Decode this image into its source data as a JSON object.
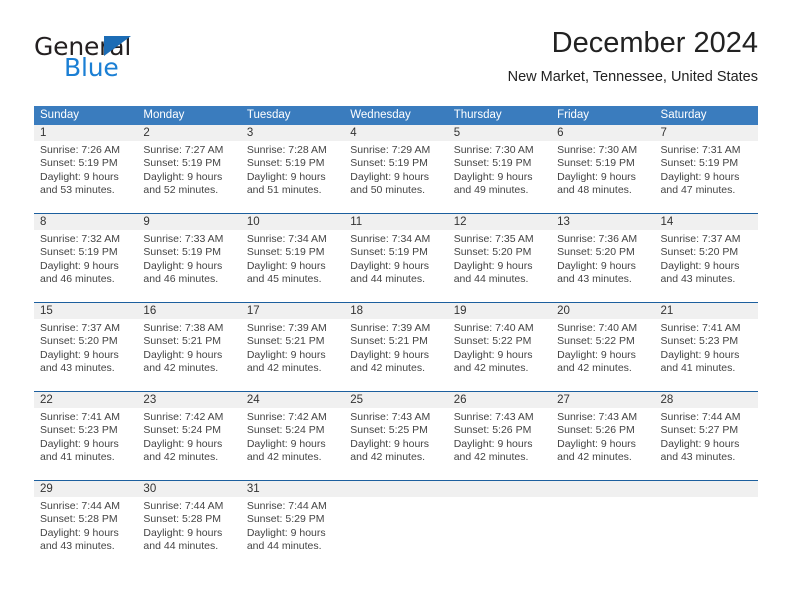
{
  "brand": {
    "name_part1": "General",
    "name_part2": "Blue",
    "triangle_icon": "triangle-icon",
    "colors": {
      "general": "#231f20",
      "blue": "#1b7fd4",
      "triangle": "#1c6cb5"
    }
  },
  "header": {
    "title": "December 2024",
    "location": "New Market, Tennessee, United States"
  },
  "theme": {
    "header_band": "#3a7cbe",
    "week_divider": "#1c5f9e",
    "daynum_band": "#f0f0f0",
    "text": "#444444"
  },
  "calendar": {
    "day_headers": [
      "Sunday",
      "Monday",
      "Tuesday",
      "Wednesday",
      "Thursday",
      "Friday",
      "Saturday"
    ],
    "weeks": [
      {
        "numbers": [
          "1",
          "2",
          "3",
          "4",
          "5",
          "6",
          "7"
        ],
        "days": [
          {
            "sunrise": "Sunrise: 7:26 AM",
            "sunset": "Sunset: 5:19 PM",
            "daylight1": "Daylight: 9 hours",
            "daylight2": "and 53 minutes."
          },
          {
            "sunrise": "Sunrise: 7:27 AM",
            "sunset": "Sunset: 5:19 PM",
            "daylight1": "Daylight: 9 hours",
            "daylight2": "and 52 minutes."
          },
          {
            "sunrise": "Sunrise: 7:28 AM",
            "sunset": "Sunset: 5:19 PM",
            "daylight1": "Daylight: 9 hours",
            "daylight2": "and 51 minutes."
          },
          {
            "sunrise": "Sunrise: 7:29 AM",
            "sunset": "Sunset: 5:19 PM",
            "daylight1": "Daylight: 9 hours",
            "daylight2": "and 50 minutes."
          },
          {
            "sunrise": "Sunrise: 7:30 AM",
            "sunset": "Sunset: 5:19 PM",
            "daylight1": "Daylight: 9 hours",
            "daylight2": "and 49 minutes."
          },
          {
            "sunrise": "Sunrise: 7:30 AM",
            "sunset": "Sunset: 5:19 PM",
            "daylight1": "Daylight: 9 hours",
            "daylight2": "and 48 minutes."
          },
          {
            "sunrise": "Sunrise: 7:31 AM",
            "sunset": "Sunset: 5:19 PM",
            "daylight1": "Daylight: 9 hours",
            "daylight2": "and 47 minutes."
          }
        ]
      },
      {
        "numbers": [
          "8",
          "9",
          "10",
          "11",
          "12",
          "13",
          "14"
        ],
        "days": [
          {
            "sunrise": "Sunrise: 7:32 AM",
            "sunset": "Sunset: 5:19 PM",
            "daylight1": "Daylight: 9 hours",
            "daylight2": "and 46 minutes."
          },
          {
            "sunrise": "Sunrise: 7:33 AM",
            "sunset": "Sunset: 5:19 PM",
            "daylight1": "Daylight: 9 hours",
            "daylight2": "and 46 minutes."
          },
          {
            "sunrise": "Sunrise: 7:34 AM",
            "sunset": "Sunset: 5:19 PM",
            "daylight1": "Daylight: 9 hours",
            "daylight2": "and 45 minutes."
          },
          {
            "sunrise": "Sunrise: 7:34 AM",
            "sunset": "Sunset: 5:19 PM",
            "daylight1": "Daylight: 9 hours",
            "daylight2": "and 44 minutes."
          },
          {
            "sunrise": "Sunrise: 7:35 AM",
            "sunset": "Sunset: 5:20 PM",
            "daylight1": "Daylight: 9 hours",
            "daylight2": "and 44 minutes."
          },
          {
            "sunrise": "Sunrise: 7:36 AM",
            "sunset": "Sunset: 5:20 PM",
            "daylight1": "Daylight: 9 hours",
            "daylight2": "and 43 minutes."
          },
          {
            "sunrise": "Sunrise: 7:37 AM",
            "sunset": "Sunset: 5:20 PM",
            "daylight1": "Daylight: 9 hours",
            "daylight2": "and 43 minutes."
          }
        ]
      },
      {
        "numbers": [
          "15",
          "16",
          "17",
          "18",
          "19",
          "20",
          "21"
        ],
        "days": [
          {
            "sunrise": "Sunrise: 7:37 AM",
            "sunset": "Sunset: 5:20 PM",
            "daylight1": "Daylight: 9 hours",
            "daylight2": "and 43 minutes."
          },
          {
            "sunrise": "Sunrise: 7:38 AM",
            "sunset": "Sunset: 5:21 PM",
            "daylight1": "Daylight: 9 hours",
            "daylight2": "and 42 minutes."
          },
          {
            "sunrise": "Sunrise: 7:39 AM",
            "sunset": "Sunset: 5:21 PM",
            "daylight1": "Daylight: 9 hours",
            "daylight2": "and 42 minutes."
          },
          {
            "sunrise": "Sunrise: 7:39 AM",
            "sunset": "Sunset: 5:21 PM",
            "daylight1": "Daylight: 9 hours",
            "daylight2": "and 42 minutes."
          },
          {
            "sunrise": "Sunrise: 7:40 AM",
            "sunset": "Sunset: 5:22 PM",
            "daylight1": "Daylight: 9 hours",
            "daylight2": "and 42 minutes."
          },
          {
            "sunrise": "Sunrise: 7:40 AM",
            "sunset": "Sunset: 5:22 PM",
            "daylight1": "Daylight: 9 hours",
            "daylight2": "and 42 minutes."
          },
          {
            "sunrise": "Sunrise: 7:41 AM",
            "sunset": "Sunset: 5:23 PM",
            "daylight1": "Daylight: 9 hours",
            "daylight2": "and 41 minutes."
          }
        ]
      },
      {
        "numbers": [
          "22",
          "23",
          "24",
          "25",
          "26",
          "27",
          "28"
        ],
        "days": [
          {
            "sunrise": "Sunrise: 7:41 AM",
            "sunset": "Sunset: 5:23 PM",
            "daylight1": "Daylight: 9 hours",
            "daylight2": "and 41 minutes."
          },
          {
            "sunrise": "Sunrise: 7:42 AM",
            "sunset": "Sunset: 5:24 PM",
            "daylight1": "Daylight: 9 hours",
            "daylight2": "and 42 minutes."
          },
          {
            "sunrise": "Sunrise: 7:42 AM",
            "sunset": "Sunset: 5:24 PM",
            "daylight1": "Daylight: 9 hours",
            "daylight2": "and 42 minutes."
          },
          {
            "sunrise": "Sunrise: 7:43 AM",
            "sunset": "Sunset: 5:25 PM",
            "daylight1": "Daylight: 9 hours",
            "daylight2": "and 42 minutes."
          },
          {
            "sunrise": "Sunrise: 7:43 AM",
            "sunset": "Sunset: 5:26 PM",
            "daylight1": "Daylight: 9 hours",
            "daylight2": "and 42 minutes."
          },
          {
            "sunrise": "Sunrise: 7:43 AM",
            "sunset": "Sunset: 5:26 PM",
            "daylight1": "Daylight: 9 hours",
            "daylight2": "and 42 minutes."
          },
          {
            "sunrise": "Sunrise: 7:44 AM",
            "sunset": "Sunset: 5:27 PM",
            "daylight1": "Daylight: 9 hours",
            "daylight2": "and 43 minutes."
          }
        ]
      },
      {
        "numbers": [
          "29",
          "30",
          "31",
          "",
          "",
          "",
          ""
        ],
        "days": [
          {
            "sunrise": "Sunrise: 7:44 AM",
            "sunset": "Sunset: 5:28 PM",
            "daylight1": "Daylight: 9 hours",
            "daylight2": "and 43 minutes."
          },
          {
            "sunrise": "Sunrise: 7:44 AM",
            "sunset": "Sunset: 5:28 PM",
            "daylight1": "Daylight: 9 hours",
            "daylight2": "and 44 minutes."
          },
          {
            "sunrise": "Sunrise: 7:44 AM",
            "sunset": "Sunset: 5:29 PM",
            "daylight1": "Daylight: 9 hours",
            "daylight2": "and 44 minutes."
          },
          {
            "sunrise": "",
            "sunset": "",
            "daylight1": "",
            "daylight2": ""
          },
          {
            "sunrise": "",
            "sunset": "",
            "daylight1": "",
            "daylight2": ""
          },
          {
            "sunrise": "",
            "sunset": "",
            "daylight1": "",
            "daylight2": ""
          },
          {
            "sunrise": "",
            "sunset": "",
            "daylight1": "",
            "daylight2": ""
          }
        ]
      }
    ]
  }
}
